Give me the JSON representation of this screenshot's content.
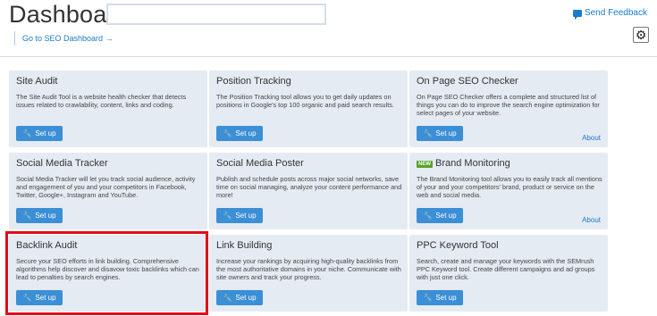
{
  "header": {
    "title": "Dashboard:",
    "title_input_value": "",
    "feedback_label": "Send Feedback",
    "seo_dashboard_link": "Go to SEO Dashboard",
    "seo_dashboard_arrow": "→",
    "settings_icon": "gear-icon"
  },
  "cards": [
    {
      "title": "Site Audit",
      "description": "The Site Audit Tool is a website health checker that detects issues related to crawlability, content, links and coding.",
      "setup": "Set up",
      "about": ""
    },
    {
      "title": "Position Tracking",
      "description": "The Position Tracking tool allows you to get daily updates on positions in Google's top 100 organic and paid search results.",
      "setup": "Set up",
      "about": ""
    },
    {
      "title": "On Page SEO Checker",
      "description": "On Page SEO Checker offers a complete and structured list of things you can do to improve the search engine optimization for select pages of your website.",
      "setup": "Set up",
      "about": "About"
    },
    {
      "title": "Social Media Tracker",
      "description": "Social Media Tracker will let you track social audience, activity and engagement of you and your competitors in Facebook, Twitter, Google+, Instagram and YouTube.",
      "setup": "Set up",
      "about": ""
    },
    {
      "title": "Social Media Poster",
      "description": "Publish and schedule posts across major social networks, save time on social managing, analyze your content performance and more!",
      "setup": "Set up",
      "about": ""
    },
    {
      "title": "Brand Monitoring",
      "badge": "NEW",
      "description": "The Brand Monitoring tool allows you to easily track all mentions of your and your competitors' brand, product or service on the web and social media.",
      "setup": "Set up",
      "about": "About"
    },
    {
      "title": "Backlink Audit",
      "description": "Secure your SEO efforts in link building. Comprehensive algorithms help discover and disavow toxic backlinks which can lead to penalties by search engines.",
      "setup": "Set up",
      "about": ""
    },
    {
      "title": "Link Building",
      "description": "Increase your rankings by acquiring high-quality backlinks from the most authoritative domains in your niche. Communicate with site owners and track your progress.",
      "setup": "Set up",
      "about": ""
    },
    {
      "title": "PPC Keyword Tool",
      "description": "Search, create and manage your keywords with the SEMrush PPC Keyword tool. Create different campaigns and ad groups with just one click.",
      "setup": "Set up",
      "about": ""
    }
  ],
  "icons": {
    "setup": "wrench-icon",
    "feedback": "chat-bubble-icon"
  },
  "colors": {
    "accent": "#3b8fd6",
    "link": "#1a7acb",
    "card_bg": "#e5ebf2",
    "highlight": "#e40b17",
    "badge": "#5aa12a"
  }
}
